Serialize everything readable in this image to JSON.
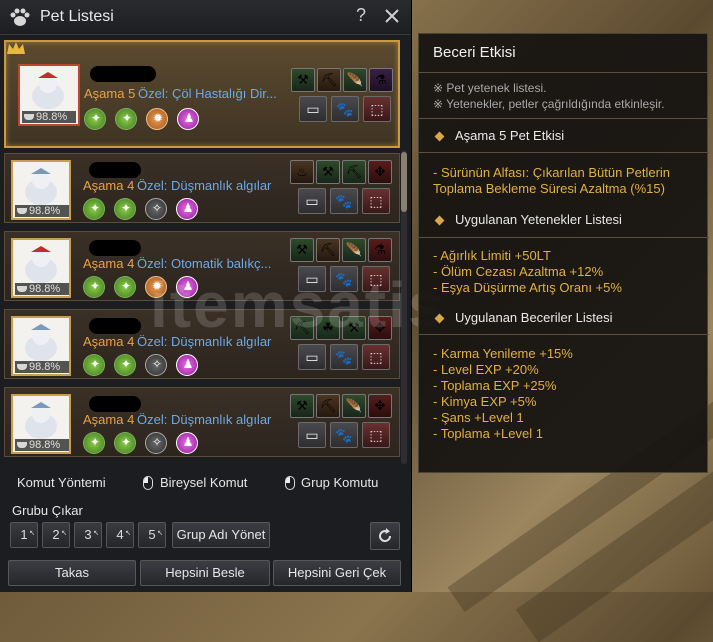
{
  "window": {
    "title": "Pet Listesi",
    "help": "?",
    "close": "✕"
  },
  "pets": [
    {
      "stage_label": "Aşama",
      "stage_num": "5",
      "special": "Özel: Çöl Hastalığı Dir...",
      "hp": "98.8%",
      "skills": [
        "green",
        "green",
        "orange",
        "purple"
      ],
      "squares": [
        [
          "g",
          "⚒"
        ],
        [
          "o",
          "⛏"
        ],
        [
          "g",
          "🪶"
        ],
        [
          "p",
          "⚗"
        ]
      ]
    },
    {
      "stage_label": "Aşama",
      "stage_num": "4",
      "special": "Özel: Düşmanlık algılar",
      "hp": "98.8%",
      "skills": [
        "green",
        "green",
        "gray",
        "purple"
      ],
      "squares": [
        [
          "o",
          "♨"
        ],
        [
          "g",
          "⚒"
        ],
        [
          "g",
          "⛏"
        ],
        [
          "r",
          "✥"
        ]
      ]
    },
    {
      "stage_label": "Aşama",
      "stage_num": "4",
      "special": "Özel: Otomatik balıkç...",
      "hp": "98.8%",
      "skills": [
        "green",
        "green",
        "orange",
        "purple"
      ],
      "squares": [
        [
          "g",
          "⚒"
        ],
        [
          "o",
          "⛏"
        ],
        [
          "g",
          "🪶"
        ],
        [
          "r",
          "⚗"
        ]
      ]
    },
    {
      "stage_label": "Aşama",
      "stage_num": "4",
      "special": "Özel: Düşmanlık algılar",
      "hp": "98.8%",
      "skills": [
        "green",
        "green",
        "gray",
        "purple"
      ],
      "squares": [
        [
          "g",
          "⛏"
        ],
        [
          "g",
          "☘"
        ],
        [
          "g",
          "⚒"
        ],
        [
          "r",
          "✥"
        ]
      ]
    },
    {
      "stage_label": "Aşama",
      "stage_num": "4",
      "special": "Özel: Düşmanlık algılar",
      "hp": "98.8%",
      "skills": [
        "green",
        "green",
        "gray",
        "purple"
      ],
      "squares": [
        [
          "g",
          "⚒"
        ],
        [
          "o",
          "⛏"
        ],
        [
          "g",
          "🪶"
        ],
        [
          "r",
          "✥"
        ]
      ]
    }
  ],
  "controls": {
    "command_method": "Komut Yöntemi",
    "individual": "Bireysel Komut",
    "group": "Grup Komutu",
    "group_remove": "Grubu Çıkar",
    "groups": [
      "1",
      "2",
      "3",
      "4",
      "5"
    ],
    "manage_group": "Grup Adı Yönet",
    "swap": "Takas",
    "feed_all": "Hepsini Besle",
    "recall_all": "Hepsini Geri Çek"
  },
  "tooltip": {
    "title": "Beceri Etkisi",
    "note1": "※ Pet yetenek listesi.",
    "note2": "※ Yetenekler, petler çağrıldığında etkinleşir.",
    "stage_head": "Aşama 5 Pet Etkisi",
    "stage_body": "- Sürünün Alfası: Çıkarılan Bütün Petlerin Toplama Bekleme Süresi Azaltma (%15)",
    "applied_head": "Uygulanan Yetenekler Listesi",
    "applied": [
      "- Ağırlık Limiti +50LT",
      "- Ölüm Cezası Azaltma +12%",
      "- Eşya Düşürme Artış Oranı +5%"
    ],
    "skills_head": "Uygulanan Beceriler Listesi",
    "skills": [
      "- Karma Yenileme +15%",
      "- Level EXP +20%",
      "- Toplama EXP +25%",
      "- Kimya EXP +5%",
      "- Şans +Level 1",
      "- Toplama +Level 1"
    ]
  },
  "watermark": "itemsatis",
  "colors": {
    "accent_gold": "#c99a3e",
    "stage_orange": "#e8a24a",
    "special_blue": "#6ea8e6",
    "effect_yellow": "#e0b040"
  }
}
